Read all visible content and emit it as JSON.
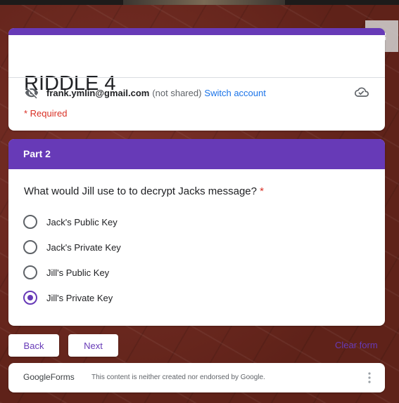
{
  "form": {
    "title": "RIDDLE 4",
    "email": "frank.ymlin@gmail.com",
    "not_shared": "(not shared)",
    "switch_account": "Switch account",
    "required_note": "* Required"
  },
  "section": {
    "title": "Part 2",
    "question": "What would Jill use to to decrypt Jacks message?",
    "required_star": "*",
    "options": [
      {
        "label": "Jack's Public Key",
        "selected": false
      },
      {
        "label": "Jack's Private Key",
        "selected": false
      },
      {
        "label": "Jill's Public Key",
        "selected": false
      },
      {
        "label": "Jill's Private Key",
        "selected": true
      }
    ]
  },
  "nav": {
    "back_label": "Back",
    "next_label": "Next",
    "clear_label": "Clear form"
  },
  "footer": {
    "logo_google": "Google",
    "logo_forms": "Forms",
    "disclaimer": "This content is neither created nor endorsed by Google."
  },
  "icons": {
    "open_external": "open-in-new-icon",
    "hidden": "eye-off-icon",
    "cloud": "cloud-done-icon",
    "more": "more-vert-icon"
  },
  "colors": {
    "accent": "#673ab7",
    "required": "#d93025",
    "link": "#1a73e8",
    "background": "#6e2a22"
  }
}
